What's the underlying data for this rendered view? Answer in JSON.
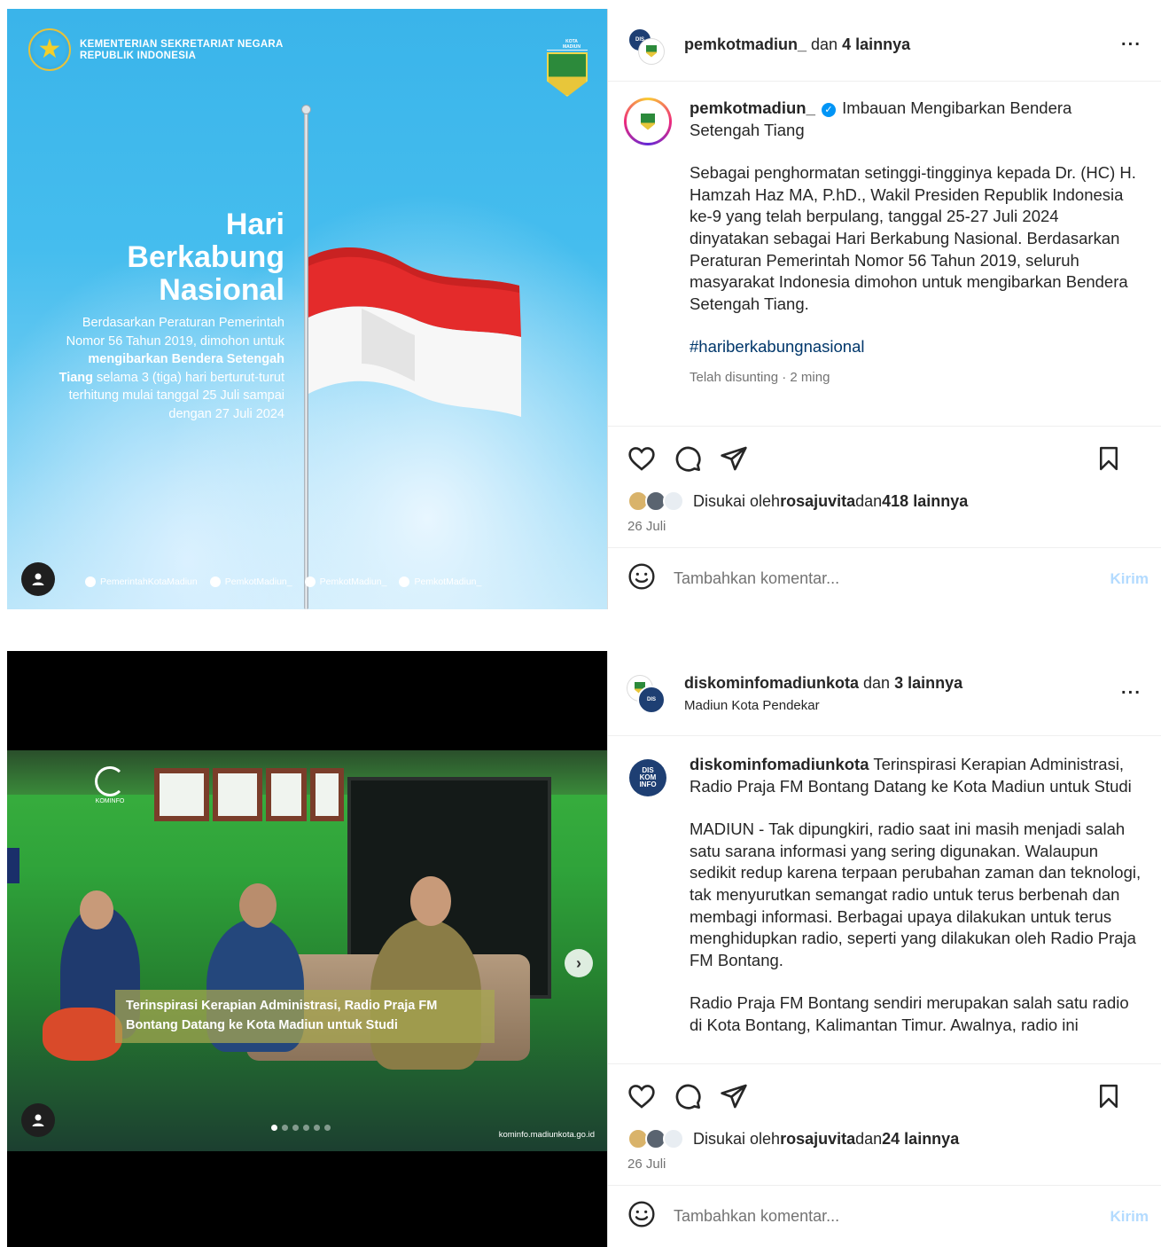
{
  "post1": {
    "media": {
      "org_line1": "KEMENTERIAN SEKRETARIAT NEGARA",
      "org_line2": "REPUBLIK INDONESIA",
      "badge_caption": "KOTA MADIUN",
      "title_line1": "Hari",
      "title_line2": "Berkabung",
      "title_line3": "Nasional",
      "desc_part1": "Berdasarkan Peraturan Pemerintah Nomor 56 Tahun 2019, dimohon untuk ",
      "desc_bold": "mengibarkan Bendera Setengah Tiang",
      "desc_part2": " selama 3 (tiga) hari berturut-turut terhitung mulai tanggal 25 Juli sampai dengan 27 Juli 2024",
      "socials": [
        "PemerintahKotaMadiun",
        "PemkotMadiun_",
        "PemkotMadiun_",
        "PemkotMadiun_"
      ]
    },
    "header": {
      "user": "pemkotmadiun_",
      "joiner": " dan ",
      "others": "4 lainnya"
    },
    "caption": {
      "user": "pemkotmadiun_",
      "title": "Imbauan Mengibarkan Bendera Setengah Tiang",
      "body": "Sebagai penghormatan setinggi-tingginya kepada Dr. (HC) H. Hamzah Haz MA, P.hD., Wakil Presiden Republik Indonesia ke-9 yang telah berpulang, tanggal 25-27 Juli 2024 dinyatakan sebagai Hari Berkabung Nasional. Berdasarkan Peraturan Pemerintah Nomor 56 Tahun 2019, seluruh masyarakat Indonesia dimohon untuk mengibarkan Bendera Setengah Tiang.",
      "hashtag": "#hariberkabungnasional",
      "meta": "Telah disunting · 2 ming"
    },
    "likes": {
      "prefix": "Disukai oleh ",
      "user": "rosajuvita",
      "joiner": " dan ",
      "count": "418 lainnya"
    },
    "date": "26 Juli",
    "comment_placeholder": "Tambahkan komentar...",
    "send_label": "Kirim"
  },
  "post2": {
    "media": {
      "brand": "KOMINFO",
      "caption_overlay": "Terinspirasi Kerapian Administrasi, Radio Praja FM Bontang Datang ke Kota Madiun untuk Studi",
      "site": "kominfo.madiunkota.go.id"
    },
    "header": {
      "user": "diskominfomadiunkota",
      "joiner": " dan ",
      "others": "3 lainnya",
      "location": "Madiun Kota Pendekar"
    },
    "caption": {
      "user": "diskominfomadiunkota",
      "title": "Terinspirasi Kerapian Administrasi, Radio Praja FM Bontang Datang ke Kota Madiun untuk Studi",
      "body1": "MADIUN - Tak dipungkiri, radio saat ini masih menjadi salah satu sarana informasi yang sering digunakan. Walaupun sedikit redup karena terpaan perubahan zaman dan teknologi, tak menyurutkan semangat radio untuk terus berbenah dan membagi informasi. Berbagai upaya dilakukan untuk terus menghidupkan radio, seperti yang dilakukan oleh Radio Praja FM Bontang.",
      "body2": "Radio Praja FM Bontang sendiri merupakan salah satu radio di Kota Bontang, Kalimantan Timur. Awalnya, radio ini"
    },
    "likes": {
      "prefix": "Disukai oleh ",
      "user": "rosajuvita",
      "joiner": " dan ",
      "count": "24 lainnya"
    },
    "date": "26 Juli",
    "comment_placeholder": "Tambahkan komentar...",
    "send_label": "Kirim"
  },
  "colors": {
    "link": "#00376b",
    "muted": "#737373",
    "send_disabled": "#b3dbff",
    "verified": "#0095f6"
  }
}
